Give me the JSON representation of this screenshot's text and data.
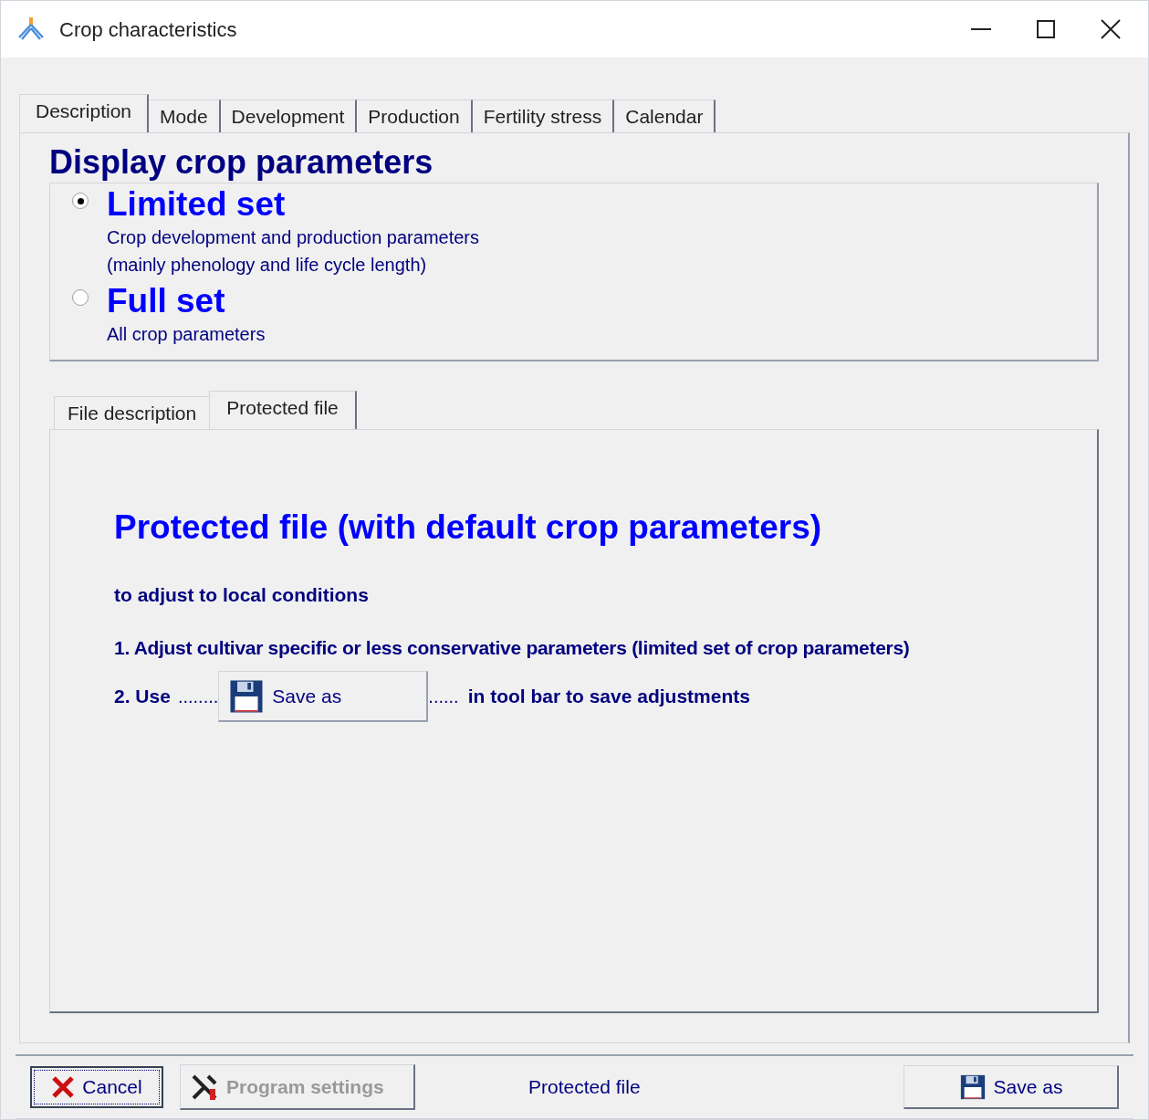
{
  "window": {
    "title": "Crop characteristics"
  },
  "tabs": [
    {
      "label": "Description",
      "selected": true
    },
    {
      "label": "Mode",
      "selected": false
    },
    {
      "label": "Development",
      "selected": false
    },
    {
      "label": "Production",
      "selected": false
    },
    {
      "label": "Fertility stress",
      "selected": false
    },
    {
      "label": "Calendar",
      "selected": false
    }
  ],
  "display": {
    "title": "Display crop parameters",
    "options": [
      {
        "label": "Limited set",
        "selected": true,
        "description": [
          "Crop development and production parameters",
          "(mainly phenology and life cycle length)"
        ]
      },
      {
        "label": "Full set",
        "selected": false,
        "description": [
          "All crop parameters"
        ]
      }
    ]
  },
  "sub_tabs": [
    {
      "label": "File description",
      "selected": false
    },
    {
      "label": "Protected file",
      "selected": true
    }
  ],
  "protected": {
    "heading": "Protected file (with default crop parameters)",
    "intro": "to adjust to local conditions",
    "step_1": "1. Adjust cultivar specific or less conservative parameters (limited set of crop parameters)",
    "step_2": {
      "prefix": "2. Use",
      "dots_before": "........",
      "button": "Save as",
      "dots_after": "......",
      "suffix": "in tool bar to save adjustments"
    }
  },
  "footer": {
    "cancel": "Cancel",
    "program_settings": {
      "label": "Program settings",
      "disabled": true
    },
    "status": "Protected file",
    "save_as": "Save as"
  }
}
